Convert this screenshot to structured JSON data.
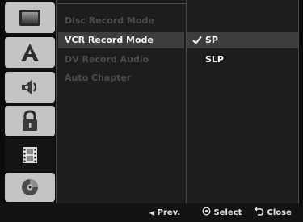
{
  "sidebar": {
    "icons": [
      {
        "name": "display-tab-icon"
      },
      {
        "name": "language-tab-icon"
      },
      {
        "name": "audio-tab-icon"
      },
      {
        "name": "lock-tab-icon"
      },
      {
        "name": "recording-tab-icon",
        "selected": true
      },
      {
        "name": "disc-tab-icon"
      }
    ]
  },
  "menu": {
    "items": [
      {
        "label": "Disc Record Mode"
      },
      {
        "label": "VCR Record Mode",
        "active": true
      },
      {
        "label": "DV Record Audio"
      },
      {
        "label": "Auto Chapter"
      }
    ]
  },
  "options": {
    "items": [
      {
        "label": "SP",
        "checked": true
      },
      {
        "label": "SLP"
      }
    ]
  },
  "footer": {
    "prev_label": "Prev.",
    "select_label": "Select",
    "close_label": "Close"
  },
  "colors": {
    "background": "#0b0b0b",
    "panel": "#1d1d1d",
    "highlight": "#3d3d3d",
    "icon_tab": "#c4c4c4",
    "dim_text": "#4c4c4c",
    "bright_text": "#f4f4f4"
  }
}
